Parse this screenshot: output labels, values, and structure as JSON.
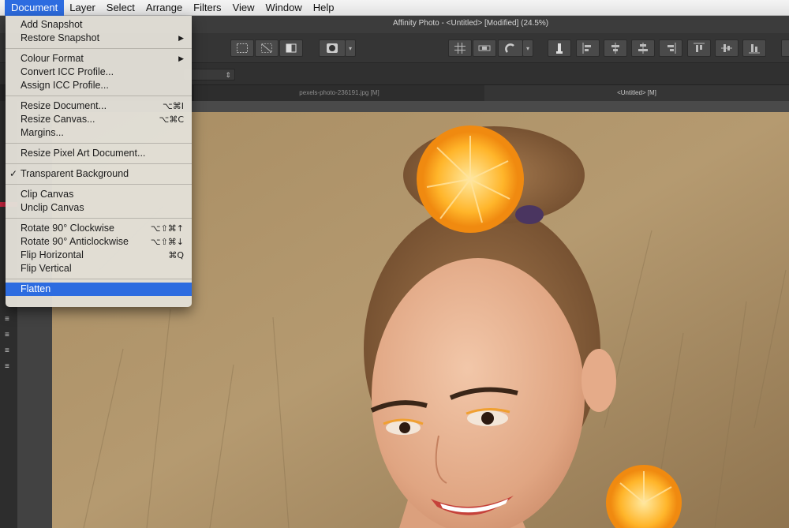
{
  "menubar": {
    "items": [
      "Document",
      "Layer",
      "Select",
      "Arrange",
      "Filters",
      "View",
      "Window",
      "Help"
    ],
    "active": "Document"
  },
  "window": {
    "title": "Affinity Photo - <Untitled> [Modified] (24.5%)"
  },
  "tabs": [
    {
      "label": "pexels-photo-236191.jpg [M]"
    },
    {
      "label": "<Untitled> [M]"
    }
  ],
  "document_menu": {
    "add_snapshot": "Add Snapshot",
    "restore_snapshot": "Restore Snapshot",
    "colour_format": "Colour Format",
    "convert_icc": "Convert ICC Profile...",
    "assign_icc": "Assign ICC Profile...",
    "resize_document": {
      "label": "Resize Document...",
      "shortcut": "⌥⌘I"
    },
    "resize_canvas": {
      "label": "Resize Canvas...",
      "shortcut": "⌥⌘C"
    },
    "margins": "Margins...",
    "resize_pixel_art": "Resize Pixel Art Document...",
    "transparent_background": "Transparent Background",
    "clip_canvas": "Clip Canvas",
    "unclip_canvas": "Unclip Canvas",
    "rotate_cw": {
      "label": "Rotate 90° Clockwise",
      "shortcut": "⌥⇧⌘↑"
    },
    "rotate_acw": {
      "label": "Rotate 90° Anticlockwise",
      "shortcut": "⌥⇧⌘↓"
    },
    "flip_horizontal": {
      "label": "Flip Horizontal",
      "shortcut": "⌘Q"
    },
    "flip_vertical": "Flip Vertical",
    "flatten": "Flatten"
  },
  "glyphs": {
    "check": "✓",
    "submenu": "▶",
    "dropdown": "⌃"
  },
  "colors": {
    "accent": "#2d6ce0",
    "menu_bg": "#e2dfd7",
    "toolbar": "#353535"
  }
}
